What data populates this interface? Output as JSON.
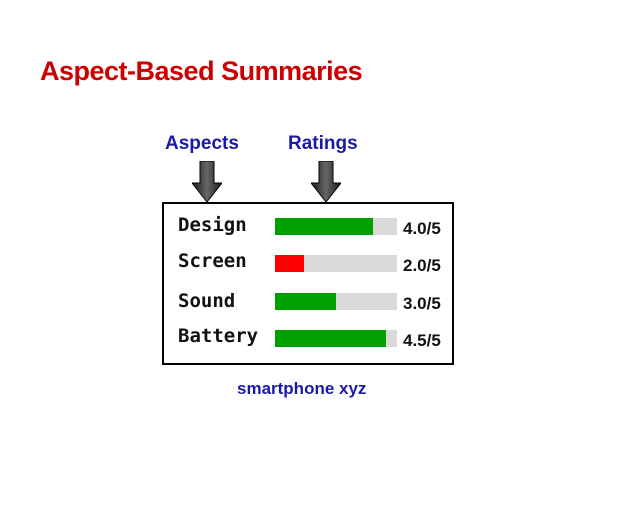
{
  "title": "Aspect-Based Summaries",
  "labels": {
    "aspects": "Aspects",
    "ratings": "Ratings"
  },
  "caption": "smartphone xyz",
  "rows": [
    {
      "aspect": "Design",
      "score": "4.0/5",
      "fraction": 0.8,
      "color": "#00a000"
    },
    {
      "aspect": "Screen",
      "score": "2.0/5",
      "fraction": 0.24,
      "color": "#ff0000"
    },
    {
      "aspect": "Sound",
      "score": "3.0/5",
      "fraction": 0.5,
      "color": "#00a000"
    },
    {
      "aspect": "Battery",
      "score": "4.5/5",
      "fraction": 0.91,
      "color": "#00a000"
    }
  ],
  "colors": {
    "title": "#cc0000",
    "header": "#1a1aa6",
    "caption": "#1a1aa6",
    "track": "#d9d9d9"
  }
}
